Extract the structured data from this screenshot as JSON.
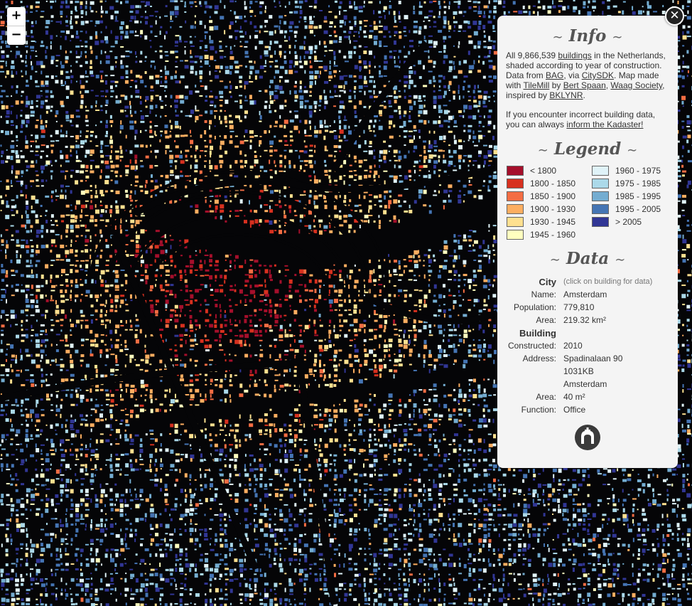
{
  "controls": {
    "zoom_in": "+",
    "zoom_out": "−",
    "close": "✕"
  },
  "info": {
    "title": "Info",
    "p1": [
      {
        "t": "All 9,866,539 "
      },
      {
        "t": "buildings",
        "link": true
      },
      {
        "t": " in the Netherlands, shaded according to year of construction. Data from "
      },
      {
        "t": "BAG",
        "link": true
      },
      {
        "t": ", via "
      },
      {
        "t": "CitySDK",
        "link": true
      },
      {
        "t": ". Map made with "
      },
      {
        "t": "TileMill",
        "link": true
      },
      {
        "t": " by "
      },
      {
        "t": "Bert Spaan",
        "link": true
      },
      {
        "t": ", "
      },
      {
        "t": "Waag Society",
        "link": true
      },
      {
        "t": ", inspired by "
      },
      {
        "t": "BKLYNR",
        "link": true
      },
      {
        "t": "."
      }
    ],
    "p2": [
      {
        "t": "If you encounter incorrect building data, you can always "
      },
      {
        "t": "inform the Kadaster!",
        "link": true
      }
    ]
  },
  "legend": {
    "title": "Legend",
    "left": [
      {
        "label": "< 1800",
        "color": "#a50f2b"
      },
      {
        "label": "1800 - 1850",
        "color": "#d7301f"
      },
      {
        "label": "1850 - 1900",
        "color": "#f46d43"
      },
      {
        "label": "1900 - 1930",
        "color": "#fdae61"
      },
      {
        "label": "1930 - 1945",
        "color": "#fee090"
      },
      {
        "label": "1945 - 1960",
        "color": "#ffffbf"
      }
    ],
    "right": [
      {
        "label": "1960 - 1975",
        "color": "#e0f3f8"
      },
      {
        "label": "1975 - 1985",
        "color": "#abd9e9"
      },
      {
        "label": "1985 - 1995",
        "color": "#74add1"
      },
      {
        "label": "1995 - 2005",
        "color": "#4575b4"
      },
      {
        "label": "> 2005",
        "color": "#313695"
      }
    ]
  },
  "data": {
    "title": "Data",
    "city_heading": "City",
    "city_note": "(click on building for data)",
    "name_label": "Name:",
    "name": "Amsterdam",
    "population_label": "Population:",
    "population": "779,810",
    "area_label": "Area:",
    "area": "219.32 km²",
    "building_heading": "Building",
    "constructed_label": "Constructed:",
    "constructed": "2010",
    "address_label": "Address:",
    "address_line1": "Spadinalaan 90",
    "address_line2": "1031KB",
    "address_line3": "Amsterdam",
    "b_area_label": "Area:",
    "b_area": "40 m²",
    "function_label": "Function:",
    "function": "Office"
  },
  "icons": {
    "zoom": "plus-minus-icons",
    "close": "close-icon",
    "logo": "waag-society-logo"
  }
}
